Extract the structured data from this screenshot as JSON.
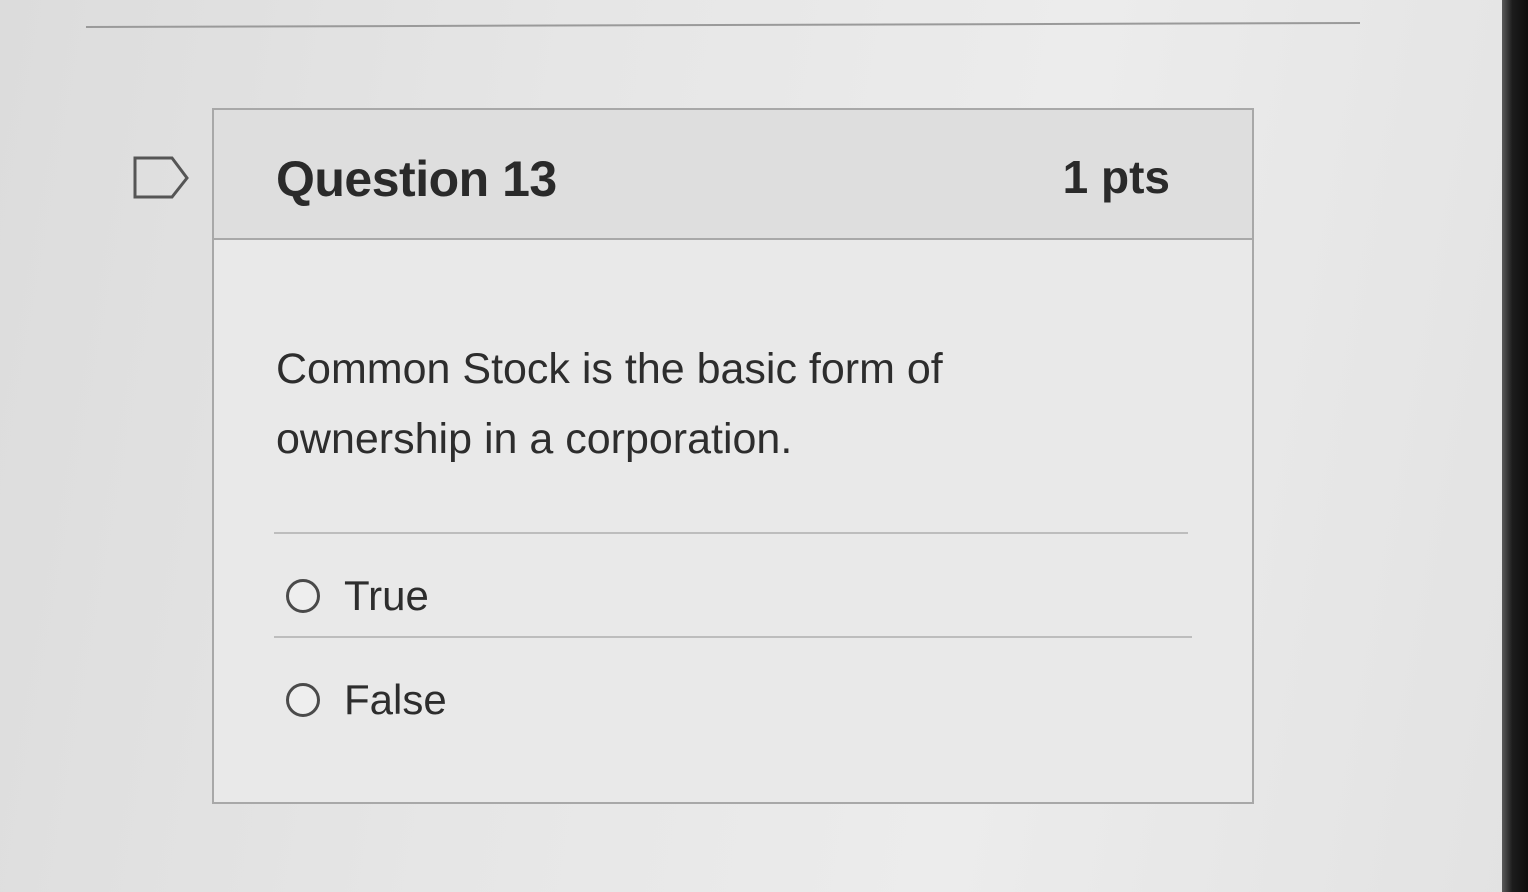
{
  "question": {
    "title": "Question 13",
    "points": "1 pts",
    "text": "Common Stock is the basic form of ownership in a corporation.",
    "answers": [
      {
        "label": "True",
        "selected": false
      },
      {
        "label": "False",
        "selected": false
      }
    ]
  },
  "icons": {
    "flag": "flag-question-icon",
    "radio": "radio-unchecked-icon"
  },
  "colors": {
    "text": "#2d2d2d",
    "header_bg": "#dedede",
    "border": "#a8a8a8"
  }
}
